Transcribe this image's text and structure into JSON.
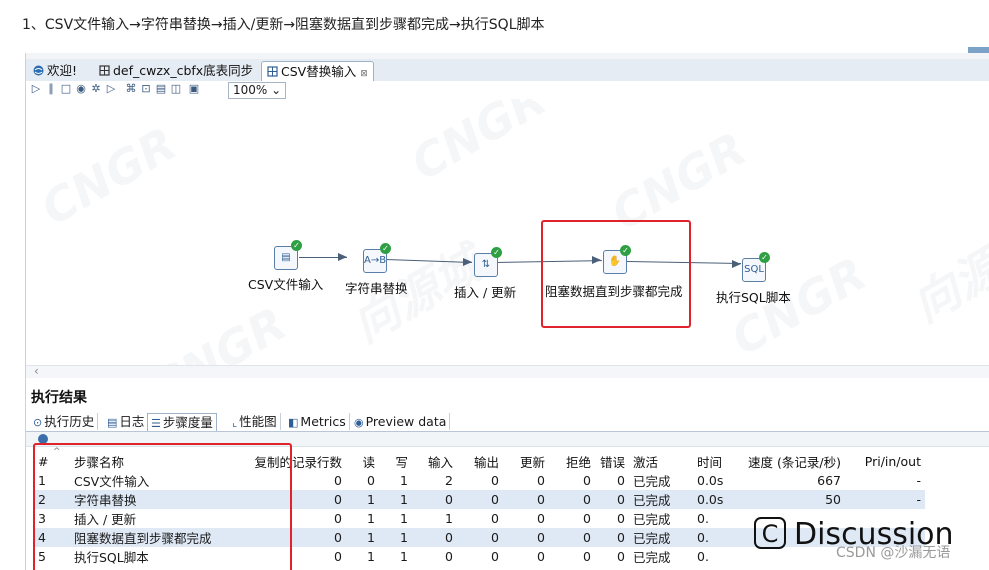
{
  "heading": "1、CSV文件输入→字符串替换→插入/更新→阻塞数据直到步骤都完成→执行SQL脚本",
  "tabs": [
    {
      "label": "欢迎!",
      "icon": "globe-icon",
      "active": false
    },
    {
      "label": "def_cwzx_cbfx底表同步",
      "icon": "job-icon",
      "active": false
    },
    {
      "label": "CSV替换输入",
      "icon": "transformation-icon",
      "active": true
    }
  ],
  "toolbar": {
    "icons": [
      "run-icon",
      "pause-icon",
      "stop-icon",
      "preview-icon",
      "debug-icon",
      "replay-icon",
      "verify-icon",
      "impact-icon",
      "sql-icon",
      "explore-icon",
      "results-icon"
    ],
    "zoom": "100%"
  },
  "canvas": {
    "watermarks": [
      "CNGR",
      "CNGR",
      "CNGR",
      "向源城",
      "CNGR",
      "向源城",
      "CNGR"
    ],
    "steps": [
      {
        "label": "CSV文件输入",
        "icon": "csv-file-icon"
      },
      {
        "label": "字符串替换",
        "icon": "string-replace-icon"
      },
      {
        "label": "插入 / 更新",
        "icon": "insert-update-icon"
      },
      {
        "label": "阻塞数据直到步骤都完成",
        "icon": "block-until-done-icon"
      },
      {
        "label": "执行SQL脚本",
        "icon": "sql-script-icon"
      }
    ]
  },
  "results": {
    "title": "执行结果",
    "tabs": [
      {
        "label": "执行历史",
        "icon": "history-icon"
      },
      {
        "label": "日志",
        "icon": "log-icon"
      },
      {
        "label": "步骤度量",
        "icon": "step-metrics-icon",
        "active": true
      },
      {
        "label": "性能图",
        "icon": "perf-chart-icon"
      },
      {
        "label": "Metrics",
        "icon": "metrics-icon"
      },
      {
        "label": "Preview data",
        "icon": "preview-data-icon"
      }
    ],
    "columns": [
      "#",
      "步骤名称",
      "复制的记录行数",
      "读",
      "写",
      "输入",
      "输出",
      "更新",
      "拒绝",
      "错误",
      "激活",
      "时间",
      "速度 (条记录/秒)",
      "Pri/in/out"
    ],
    "rows": [
      [
        "1",
        "CSV文件输入",
        "0",
        "0",
        "1",
        "2",
        "0",
        "0",
        "0",
        "0",
        "已完成",
        "0.0s",
        "667",
        "-"
      ],
      [
        "2",
        "字符串替换",
        "0",
        "1",
        "1",
        "0",
        "0",
        "0",
        "0",
        "0",
        "已完成",
        "0.0s",
        "50",
        "-"
      ],
      [
        "3",
        "插入 / 更新",
        "0",
        "1",
        "1",
        "1",
        "0",
        "0",
        "0",
        "0",
        "已完成",
        "0.",
        "",
        ""
      ],
      [
        "4",
        "阻塞数据直到步骤都完成",
        "0",
        "1",
        "1",
        "0",
        "0",
        "0",
        "0",
        "0",
        "已完成",
        "0.",
        "",
        ""
      ],
      [
        "5",
        "执行SQL脚本",
        "0",
        "1",
        "1",
        "0",
        "0",
        "0",
        "0",
        "0",
        "已完成",
        "0.",
        "",
        ""
      ]
    ]
  },
  "overlay": {
    "discussion_icon": "C",
    "discussion": "Discussion",
    "csdn": "CSDN @沙漏无语"
  }
}
